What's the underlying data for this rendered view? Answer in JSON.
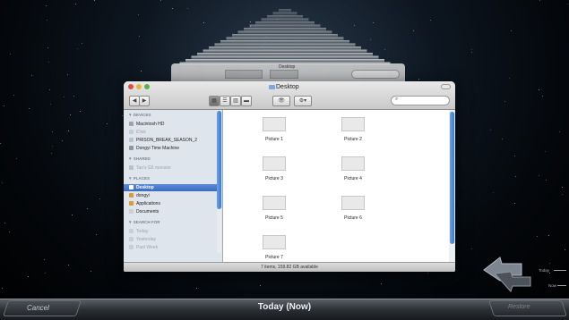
{
  "back_window": {
    "title": "Desktop"
  },
  "window": {
    "title": "Desktop",
    "toolbar": {
      "eye_label": "👁",
      "action_label": "⚙▾",
      "search_placeholder": ""
    },
    "status": "7 items, 159.82 GB available"
  },
  "sidebar": {
    "sections": [
      {
        "header": "▼ DEVICES",
        "items": [
          {
            "label": "Macintosh HD",
            "icon": "hard-drive-icon",
            "dim": false
          },
          {
            "label": "iDisk",
            "icon": "idisk-icon",
            "dim": true
          },
          {
            "label": "PRISON_BREAK_SEASON_2",
            "icon": "disc-icon",
            "dim": false
          },
          {
            "label": "Dongyi Time Machine",
            "icon": "time-machine-drive-icon",
            "dim": false
          }
        ]
      },
      {
        "header": "▼ SHARED",
        "items": [
          {
            "label": "Tao's G5 monster",
            "icon": "network-computer-icon",
            "dim": true
          }
        ]
      },
      {
        "header": "▼ PLACES",
        "items": [
          {
            "label": "Desktop",
            "icon": "desktop-icon",
            "selected": true
          },
          {
            "label": "dongyi",
            "icon": "home-icon",
            "dim": false
          },
          {
            "label": "Applications",
            "icon": "applications-icon",
            "dim": false
          },
          {
            "label": "Documents",
            "icon": "documents-icon",
            "dim": false
          }
        ]
      },
      {
        "header": "▼ SEARCH FOR",
        "items": [
          {
            "label": "Today",
            "icon": "clock-icon",
            "dim": true
          },
          {
            "label": "Yesterday",
            "icon": "clock-icon",
            "dim": true
          },
          {
            "label": "Past Week",
            "icon": "clock-icon",
            "dim": true
          }
        ]
      }
    ]
  },
  "files": [
    {
      "label": "Picture 1",
      "icon": "picture-file-icon"
    },
    {
      "label": "Picture 2",
      "icon": "picture-file-icon"
    },
    {
      "label": "Picture 3",
      "icon": "picture-file-icon"
    },
    {
      "label": "Picture 4",
      "icon": "picture-file-icon"
    },
    {
      "label": "Picture 5",
      "icon": "picture-file-icon"
    },
    {
      "label": "Picture 6",
      "icon": "picture-file-icon"
    },
    {
      "label": "Picture 7",
      "icon": "picture-file-icon"
    }
  ],
  "bottom_bar": {
    "cancel": "Cancel",
    "current": "Today (Now)",
    "restore": "Restore"
  },
  "timeline": {
    "today": "Today",
    "now": "Now"
  },
  "colors": {
    "selection": "#3a6cc2",
    "background": "#04070b",
    "bar": "#2a2e33"
  }
}
